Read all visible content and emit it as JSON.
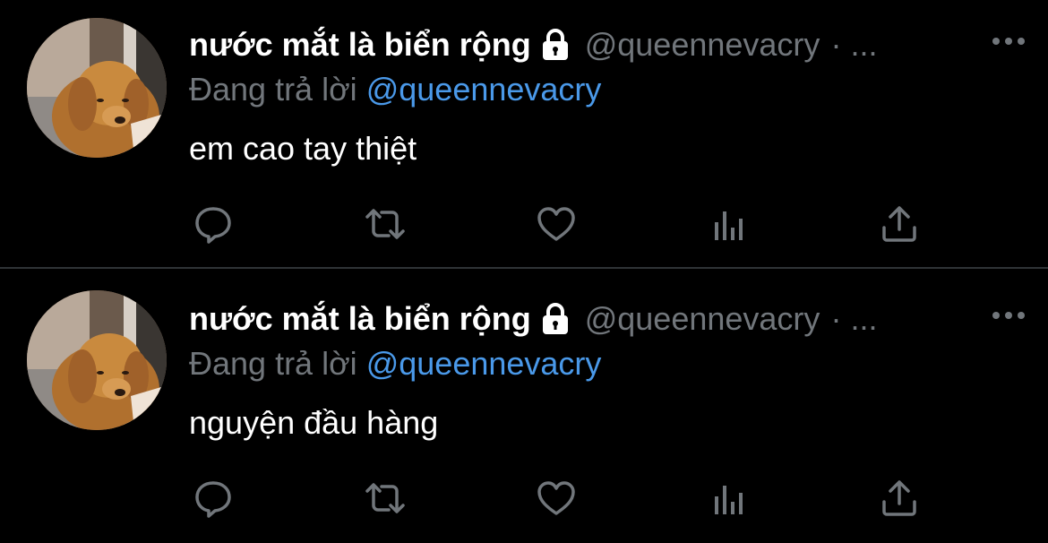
{
  "colors": {
    "background": "#000000",
    "divider": "#2f3336",
    "secondary_text": "#71767b",
    "mention": "#4a99e9",
    "primary_text": "#ffffff"
  },
  "tweets": [
    {
      "display_name": "nước mắt là biển rộng",
      "handle": "@queennevacry",
      "separator": "·",
      "truncation": "...",
      "reply_prefix": "Đang trả lời",
      "reply_mention": "@queennevacry",
      "text": "em cao tay thiệt",
      "icons": [
        "lock-icon",
        "more-icon",
        "reply-icon",
        "retweet-icon",
        "like-icon",
        "analytics-icon",
        "share-icon"
      ]
    },
    {
      "display_name": "nước mắt là biển rộng",
      "handle": "@queennevacry",
      "separator": "·",
      "truncation": "...",
      "reply_prefix": "Đang trả lời",
      "reply_mention": "@queennevacry",
      "text": "nguyện đầu hàng",
      "icons": [
        "lock-icon",
        "more-icon",
        "reply-icon",
        "retweet-icon",
        "like-icon",
        "analytics-icon",
        "share-icon"
      ]
    }
  ]
}
